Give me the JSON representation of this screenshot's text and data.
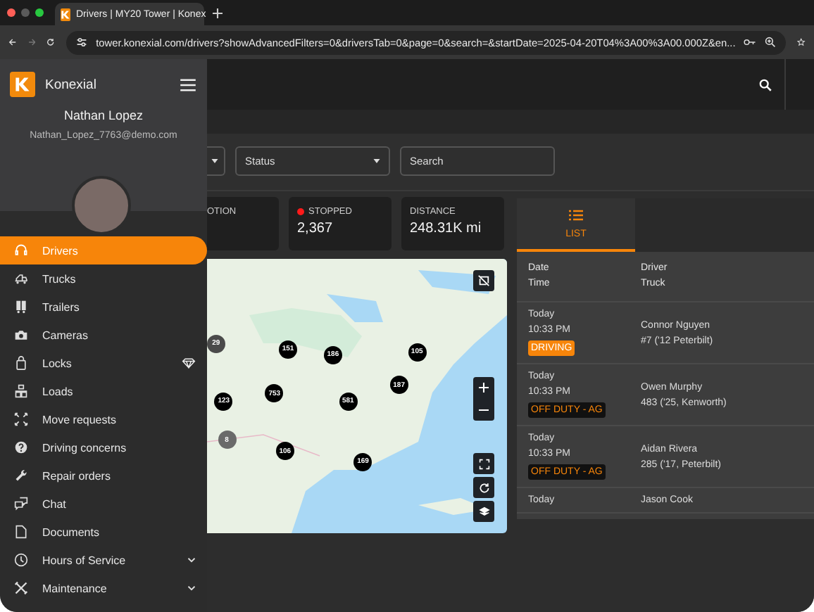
{
  "browser": {
    "tab_title": "Drivers | MY20 Tower | Konex",
    "url": "tower.konexial.com/drivers?showAdvancedFilters=0&driversTab=0&page=0&search=&startDate=2025-04-20T04%3A00%3A00.000Z&en..."
  },
  "sidebar": {
    "brand": "Konexial",
    "user_name": "Nathan Lopez",
    "user_email": "Nathan_Lopez_7763@demo.com",
    "items": [
      {
        "label": "Drivers",
        "selected": true
      },
      {
        "label": "Trucks",
        "selected": false
      },
      {
        "label": "Trailers",
        "selected": false
      },
      {
        "label": "Cameras",
        "selected": false
      },
      {
        "label": "Locks",
        "selected": false,
        "premium": true
      },
      {
        "label": "Loads",
        "selected": false
      },
      {
        "label": "Move requests",
        "selected": false
      },
      {
        "label": "Driving concerns",
        "selected": false
      },
      {
        "label": "Repair orders",
        "selected": false
      },
      {
        "label": "Chat",
        "selected": false
      },
      {
        "label": "Documents",
        "selected": false
      },
      {
        "label": "Hours of Service",
        "selected": false,
        "expanded": false
      },
      {
        "label": "Maintenance",
        "selected": false,
        "expanded": false
      }
    ]
  },
  "filters": {
    "status_placeholder": "Status",
    "search_placeholder": "Search"
  },
  "stats": [
    {
      "label": "OTION"
    },
    {
      "label": "STOPPED",
      "value": "2,367",
      "color": "#ff1a1a"
    },
    {
      "label": "DISTANCE",
      "value": "248.31K mi"
    }
  ],
  "map": {
    "clusters": [
      {
        "count": "29",
        "color": "#4a4a4a"
      },
      {
        "count": "151",
        "color": "#000000"
      },
      {
        "count": "186",
        "color": "#000000"
      },
      {
        "count": "105",
        "color": "#000000"
      },
      {
        "count": "187",
        "color": "#000000"
      },
      {
        "count": "753",
        "color": "#000000"
      },
      {
        "count": "123",
        "color": "#000000"
      },
      {
        "count": "581",
        "color": "#000000"
      },
      {
        "count": "8",
        "color": "#6a6a6a"
      },
      {
        "count": "106",
        "color": "#000000"
      },
      {
        "count": "169",
        "color": "#000000"
      }
    ]
  },
  "list": {
    "tab_label": "LIST",
    "tab_selected": true,
    "columns": [
      {
        "top": "Date",
        "bottom": "Time"
      },
      {
        "top": "Driver",
        "bottom": "Truck"
      }
    ],
    "rows": [
      {
        "date": "Today",
        "time": "10:33 PM",
        "status": {
          "kind": "driving",
          "label": "DRIVING"
        },
        "driver": "Connor Nguyen",
        "truck": "#7 ('12 Peterbilt)"
      },
      {
        "date": "Today",
        "time": "10:33 PM",
        "status": {
          "kind": "off_duty",
          "label": "OFF DUTY - AG"
        },
        "driver": "Owen Murphy",
        "truck": "483 ('25, Kenworth)"
      },
      {
        "date": "Today",
        "time": "10:33 PM",
        "status": {
          "kind": "off_duty",
          "label": "OFF DUTY - AG"
        },
        "driver": "Aidan Rivera",
        "truck": "285 ('17, Peterbilt)"
      },
      {
        "date": "Today",
        "driver": "Jason Cook"
      }
    ]
  }
}
